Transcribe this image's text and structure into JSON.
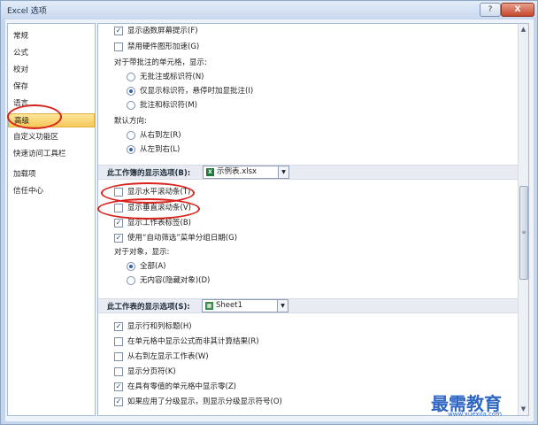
{
  "window": {
    "title": "Excel 选项",
    "help": "?",
    "close": "X"
  },
  "nav": {
    "items": [
      {
        "label": "常规"
      },
      {
        "label": "公式"
      },
      {
        "label": "校对"
      },
      {
        "label": "保存"
      },
      {
        "label": "语言"
      },
      {
        "label": "高级",
        "selected": true
      },
      {
        "label": "自定义功能区"
      },
      {
        "label": "快速访问工具栏"
      },
      {
        "label": "加载项"
      },
      {
        "label": "信任中心"
      }
    ]
  },
  "display": {
    "formula_tips": "显示函数屏幕提示(F)",
    "disable_hw_accel": "禁用硬件图形加速(G)",
    "comment_heading": "对于带批注的单元格，显示:",
    "comment_opt1": "无批注或标识符(N)",
    "comment_opt2": "仅显示标识符，悬停时加显批注(I)",
    "comment_opt3": "批注和标识符(M)",
    "direction_heading": "默认方向:",
    "dir_rtl": "从右到左(R)",
    "dir_ltr": "从左到右(L)"
  },
  "workbook": {
    "section": "此工作簿的显示选项(B):",
    "file": "示例表.xlsx",
    "hscroll": "显示水平滚动条(T)",
    "vscroll": "显示垂直滚动条(V)",
    "sheet_tabs": "显示工作表标签(B)",
    "autofilter_group": "使用“自动筛选”菜单分组日期(G)",
    "objects_heading": "对于对象，显示:",
    "obj_all": "全部(A)",
    "obj_none": "无内容(隐藏对象)(D)"
  },
  "worksheet": {
    "section": "此工作表的显示选项(S):",
    "sheet": "Sheet1",
    "headers": "显示行和列标题(H)",
    "formulas": "在单元格中显示公式而非其计算结果(R)",
    "rtl": "从右到左显示工作表(W)",
    "page_breaks": "显示分页符(K)",
    "zero": "在具有零值的单元格中显示零(Z)",
    "outline": "如果应用了分级显示，则显示分级显示符号(O)"
  },
  "watermark": {
    "text": "最需教育",
    "url": "www.xuexila.com"
  },
  "colors": {
    "annotation": "#d8231d",
    "selected_nav": "#f6c85a",
    "watermark": "#2f66c4"
  }
}
